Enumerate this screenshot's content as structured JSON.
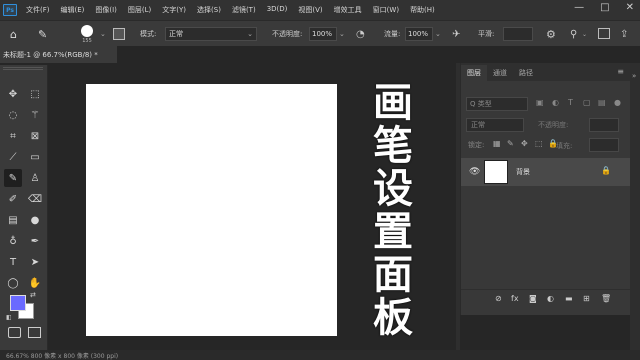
{
  "menubar": {
    "logo": "Ps",
    "items": [
      "文件(F)",
      "编辑(E)",
      "图像(I)",
      "图层(L)",
      "文字(Y)",
      "选择(S)",
      "滤镜(T)",
      "3D(D)",
      "视图(V)",
      "增效工具",
      "窗口(W)",
      "帮助(H)"
    ],
    "window_controls": [
      "—",
      "□",
      "✕"
    ]
  },
  "options": {
    "brush_size": "155",
    "mode_label": "模式:",
    "mode_value": "正常",
    "opacity_label": "不透明度:",
    "opacity_value": "100%",
    "flow_label": "流量:",
    "flow_value": "100%",
    "smooth_label": "平滑:"
  },
  "document": {
    "tab_title": "未标题-1 @ 66.7%(RGB/8) *",
    "status": "66.67%    800 像素 x 800 像素 (300 ppi)"
  },
  "caption": [
    "画",
    "笔",
    "设",
    "置",
    "面",
    "板"
  ],
  "layers_panel": {
    "tabs": [
      "图层",
      "通道",
      "路径"
    ],
    "filter_placeholder": "Q 类型",
    "blend_mode": "正常",
    "opacity_label": "不透明度:",
    "lock_label": "锁定:",
    "fill_label": "填充:",
    "layers": [
      {
        "name": "背景",
        "visible": true,
        "locked": true
      }
    ]
  },
  "colors": {
    "foreground": "#6a6aff",
    "background": "#ffffff"
  }
}
